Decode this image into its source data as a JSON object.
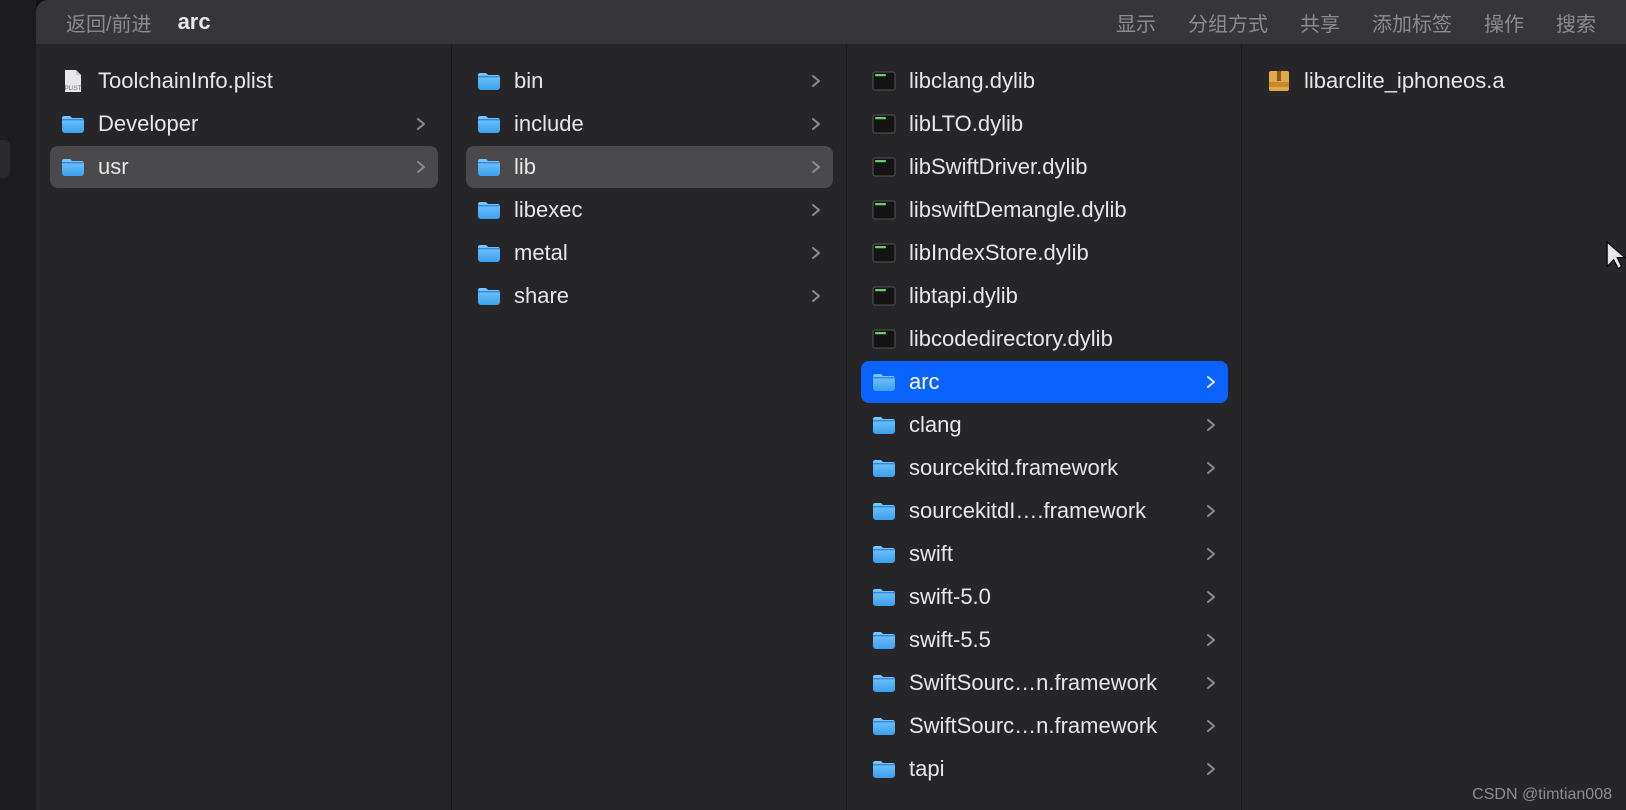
{
  "toolbar": {
    "back_forward": "返回/前进",
    "title": "arc",
    "items": [
      "显示",
      "分组方式",
      "共享",
      "添加标签",
      "操作",
      "搜索"
    ]
  },
  "columns": [
    {
      "id": "col1",
      "items": [
        {
          "name": "ToolchainInfo.plist",
          "icon": "plist",
          "has_children": false
        },
        {
          "name": "Developer",
          "icon": "folder",
          "has_children": true
        },
        {
          "name": "usr",
          "icon": "folder",
          "has_children": true,
          "state": "path"
        }
      ]
    },
    {
      "id": "col2",
      "items": [
        {
          "name": "bin",
          "icon": "folder",
          "has_children": true
        },
        {
          "name": "include",
          "icon": "folder",
          "has_children": true
        },
        {
          "name": "lib",
          "icon": "folder",
          "has_children": true,
          "state": "path"
        },
        {
          "name": "libexec",
          "icon": "folder",
          "has_children": true
        },
        {
          "name": "metal",
          "icon": "folder",
          "has_children": true
        },
        {
          "name": "share",
          "icon": "folder",
          "has_children": true
        }
      ]
    },
    {
      "id": "col3",
      "items": [
        {
          "name": "libclang.dylib",
          "icon": "exec",
          "has_children": false
        },
        {
          "name": "libLTO.dylib",
          "icon": "exec",
          "has_children": false
        },
        {
          "name": "libSwiftDriver.dylib",
          "icon": "exec",
          "has_children": false
        },
        {
          "name": "libswiftDemangle.dylib",
          "icon": "exec",
          "has_children": false
        },
        {
          "name": "libIndexStore.dylib",
          "icon": "exec",
          "has_children": false
        },
        {
          "name": "libtapi.dylib",
          "icon": "exec",
          "has_children": false
        },
        {
          "name": "libcodedirectory.dylib",
          "icon": "exec",
          "has_children": false
        },
        {
          "name": "arc",
          "icon": "folder",
          "has_children": true,
          "state": "selected"
        },
        {
          "name": "clang",
          "icon": "folder",
          "has_children": true
        },
        {
          "name": "sourcekitd.framework",
          "icon": "folder",
          "has_children": true
        },
        {
          "name": "sourcekitdI….framework",
          "icon": "folder",
          "has_children": true
        },
        {
          "name": "swift",
          "icon": "folder",
          "has_children": true
        },
        {
          "name": "swift-5.0",
          "icon": "folder",
          "has_children": true
        },
        {
          "name": "swift-5.5",
          "icon": "folder",
          "has_children": true
        },
        {
          "name": "SwiftSourc…n.framework",
          "icon": "folder",
          "has_children": true
        },
        {
          "name": "SwiftSourc…n.framework",
          "icon": "folder",
          "has_children": true
        },
        {
          "name": "tapi",
          "icon": "folder",
          "has_children": true
        }
      ]
    },
    {
      "id": "col4",
      "items": [
        {
          "name": "libarclite_iphoneos.a",
          "icon": "archive",
          "has_children": false
        }
      ]
    }
  ],
  "watermark": "CSDN @timtian008"
}
